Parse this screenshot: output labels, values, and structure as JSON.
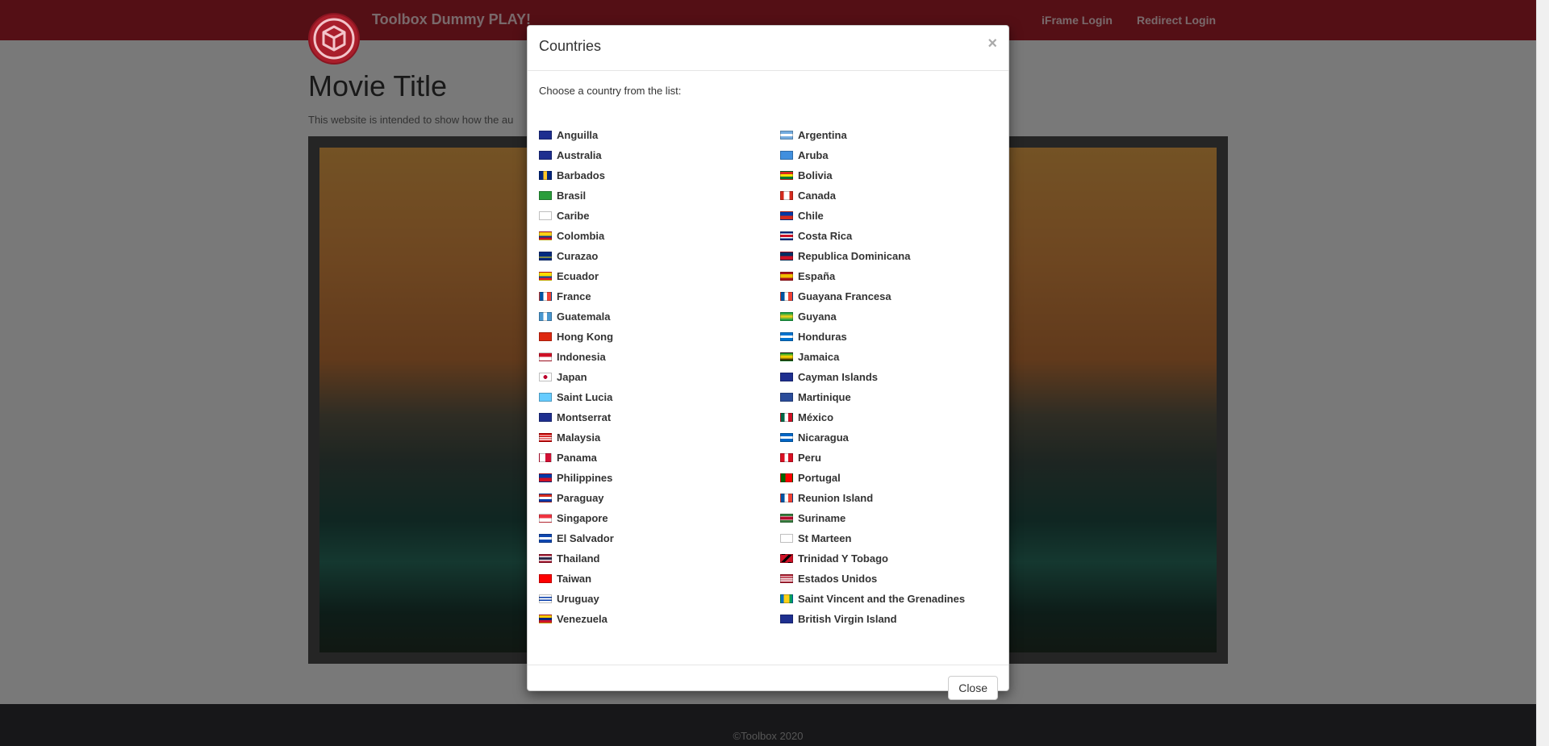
{
  "navbar": {
    "brand": "Toolbox Dummy PLAY!",
    "links": {
      "iframe": "iFrame Login",
      "redirect": "Redirect Login"
    }
  },
  "main": {
    "title": "Movie Title",
    "description": "This website is intended to show how the au"
  },
  "footer": {
    "text": "©Toolbox 2020"
  },
  "modal": {
    "title": "Countries",
    "close_symbol": "×",
    "intro": "Choose a country from the list:",
    "close_label": "Close",
    "countries_left": [
      {
        "name": "Anguilla",
        "flag": "linear-gradient(#1e2f8f,#1e2f8f)"
      },
      {
        "name": "Australia",
        "flag": "linear-gradient(#1e2f8f,#1e2f8f)"
      },
      {
        "name": "Barbados",
        "flag": "linear-gradient(90deg,#00267f 33%,#ffc726 33% 66%,#00267f 66%)"
      },
      {
        "name": "Brasil",
        "flag": "linear-gradient(#2a9d3b,#2a9d3b)"
      },
      {
        "name": "Caribe",
        "flag": "linear-gradient(#ffffff,#ffffff)"
      },
      {
        "name": "Colombia",
        "flag": "linear-gradient(#fcd116 50%,#003893 50% 75%,#ce1126 75%)"
      },
      {
        "name": "Curazao",
        "flag": "linear-gradient(#002b7f 60%,#f9e814 60% 75%,#002b7f 75%)"
      },
      {
        "name": "Ecuador",
        "flag": "linear-gradient(#ffdd00 50%,#034ea2 50% 75%,#ed1c24 75%)"
      },
      {
        "name": "France",
        "flag": "linear-gradient(90deg,#0055a4 33%,#ffffff 33% 66%,#ef4135 66%)"
      },
      {
        "name": "Guatemala",
        "flag": "linear-gradient(90deg,#4997d0 33%,#ffffff 33% 66%,#4997d0 66%)"
      },
      {
        "name": "Hong Kong",
        "flag": "linear-gradient(#de2910,#de2910)"
      },
      {
        "name": "Indonesia",
        "flag": "linear-gradient(#ce1126 50%,#ffffff 50%)"
      },
      {
        "name": "Japan",
        "flag": "radial-gradient(circle,#bc002d 28%,#ffffff 30%)"
      },
      {
        "name": "Saint Lucia",
        "flag": "linear-gradient(#66ccff,#66ccff)"
      },
      {
        "name": "Montserrat",
        "flag": "linear-gradient(#1e2f8f,#1e2f8f)"
      },
      {
        "name": "Malaysia",
        "flag": "linear-gradient(#cc0001 15%,#ffffff 15% 30%,#cc0001 30% 45%,#ffffff 45% 60%,#cc0001 60% 75%,#ffffff 75% 90%,#cc0001 90%)"
      },
      {
        "name": "Panama",
        "flag": "linear-gradient(90deg,#ffffff 50%,#d21034 50%)"
      },
      {
        "name": "Philippines",
        "flag": "linear-gradient(#0038a8 50%,#ce1126 50%)"
      },
      {
        "name": "Paraguay",
        "flag": "linear-gradient(#d52b1e 33%,#ffffff 33% 66%,#0038a8 66%)"
      },
      {
        "name": "Singapore",
        "flag": "linear-gradient(#ef3340 50%,#ffffff 50%)"
      },
      {
        "name": "El Salvador",
        "flag": "linear-gradient(#0f47af 33%,#ffffff 33% 66%,#0f47af 66%)"
      },
      {
        "name": "Thailand",
        "flag": "linear-gradient(#a51931 17%,#f4f5f8 17% 33%,#2d2a4a 33% 67%,#f4f5f8 67% 83%,#a51931 83%)"
      },
      {
        "name": "Taiwan",
        "flag": "linear-gradient(#fe0000,#fe0000)"
      },
      {
        "name": "Uruguay",
        "flag": "linear-gradient(#ffffff 20%,#0038a8 20% 40%,#ffffff 40% 60%,#0038a8 60% 80%,#ffffff 80%)"
      },
      {
        "name": "Venezuela",
        "flag": "linear-gradient(#ffcc00 33%,#00247d 33% 66%,#cf142b 66%)"
      }
    ],
    "countries_right": [
      {
        "name": "Argentina",
        "flag": "linear-gradient(#74acdf 33%,#ffffff 33% 66%,#74acdf 66%)"
      },
      {
        "name": "Aruba",
        "flag": "linear-gradient(#418fde,#418fde)"
      },
      {
        "name": "Bolivia",
        "flag": "linear-gradient(#d52b1e 33%,#f9e300 33% 66%,#007934 66%)"
      },
      {
        "name": "Canada",
        "flag": "linear-gradient(90deg,#d52b1e 25%,#ffffff 25% 75%,#d52b1e 75%)"
      },
      {
        "name": "Chile",
        "flag": "linear-gradient(#0039a6 50%,#d52b1e 50%)"
      },
      {
        "name": "Costa Rica",
        "flag": "linear-gradient(#002b7f 17%,#ffffff 17% 33%,#ce1126 33% 67%,#ffffff 67% 83%,#002b7f 83%)"
      },
      {
        "name": "Republica Dominicana",
        "flag": "linear-gradient(#002d62 50%,#ce1126 50%)"
      },
      {
        "name": "España",
        "flag": "linear-gradient(#aa151b 25%,#f1bf00 25% 75%,#aa151b 75%)"
      },
      {
        "name": "Guayana Francesa",
        "flag": "linear-gradient(90deg,#0055a4 33%,#ffffff 33% 66%,#ef4135 66%)"
      },
      {
        "name": "Guyana",
        "flag": "linear-gradient(#009e49,#fcd116 50%,#009e49)"
      },
      {
        "name": "Honduras",
        "flag": "linear-gradient(#0073cf 33%,#ffffff 33% 66%,#0073cf 66%)"
      },
      {
        "name": "Jamaica",
        "flag": "linear-gradient(#009b3a,#fed100 45% 55%,#000000)"
      },
      {
        "name": "Cayman Islands",
        "flag": "linear-gradient(#1e2f8f,#1e2f8f)"
      },
      {
        "name": "Martinique",
        "flag": "linear-gradient(#2b4c9a,#2b4c9a)"
      },
      {
        "name": "México",
        "flag": "linear-gradient(90deg,#006847 33%,#ffffff 33% 66%,#ce1126 66%)"
      },
      {
        "name": "Nicaragua",
        "flag": "linear-gradient(#0067c6 33%,#ffffff 33% 66%,#0067c6 66%)"
      },
      {
        "name": "Peru",
        "flag": "linear-gradient(90deg,#d91023 33%,#ffffff 33% 66%,#d91023 66%)"
      },
      {
        "name": "Portugal",
        "flag": "linear-gradient(90deg,#006600 40%,#ff0000 40%)"
      },
      {
        "name": "Reunion Island",
        "flag": "linear-gradient(90deg,#0055a4 33%,#ffffff 33% 66%,#ef4135 66%)"
      },
      {
        "name": "Suriname",
        "flag": "linear-gradient(#377e3f 20%,#ffffff 20% 30%,#b40a2d 30% 70%,#ffffff 70% 80%,#377e3f 80%)"
      },
      {
        "name": "St Marteen",
        "flag": "linear-gradient(#ffffff,#ffffff)"
      },
      {
        "name": "Trinidad Y Tobago",
        "flag": "linear-gradient(135deg,#ce1126 40%,#000000 40% 60%,#ce1126 60%)"
      },
      {
        "name": "Estados Unidos",
        "flag": "linear-gradient(#b22234 15%,#ffffff 15% 30%,#b22234 30% 45%,#ffffff 45% 60%,#b22234 60% 75%,#ffffff 75% 90%,#b22234 90%)"
      },
      {
        "name": "Saint Vincent and the Grenadines",
        "flag": "linear-gradient(90deg,#0072c6 25%,#fcd116 25% 75%,#009e60 75%)"
      },
      {
        "name": "British Virgin Island",
        "flag": "linear-gradient(#1e2f8f,#1e2f8f)"
      }
    ]
  }
}
